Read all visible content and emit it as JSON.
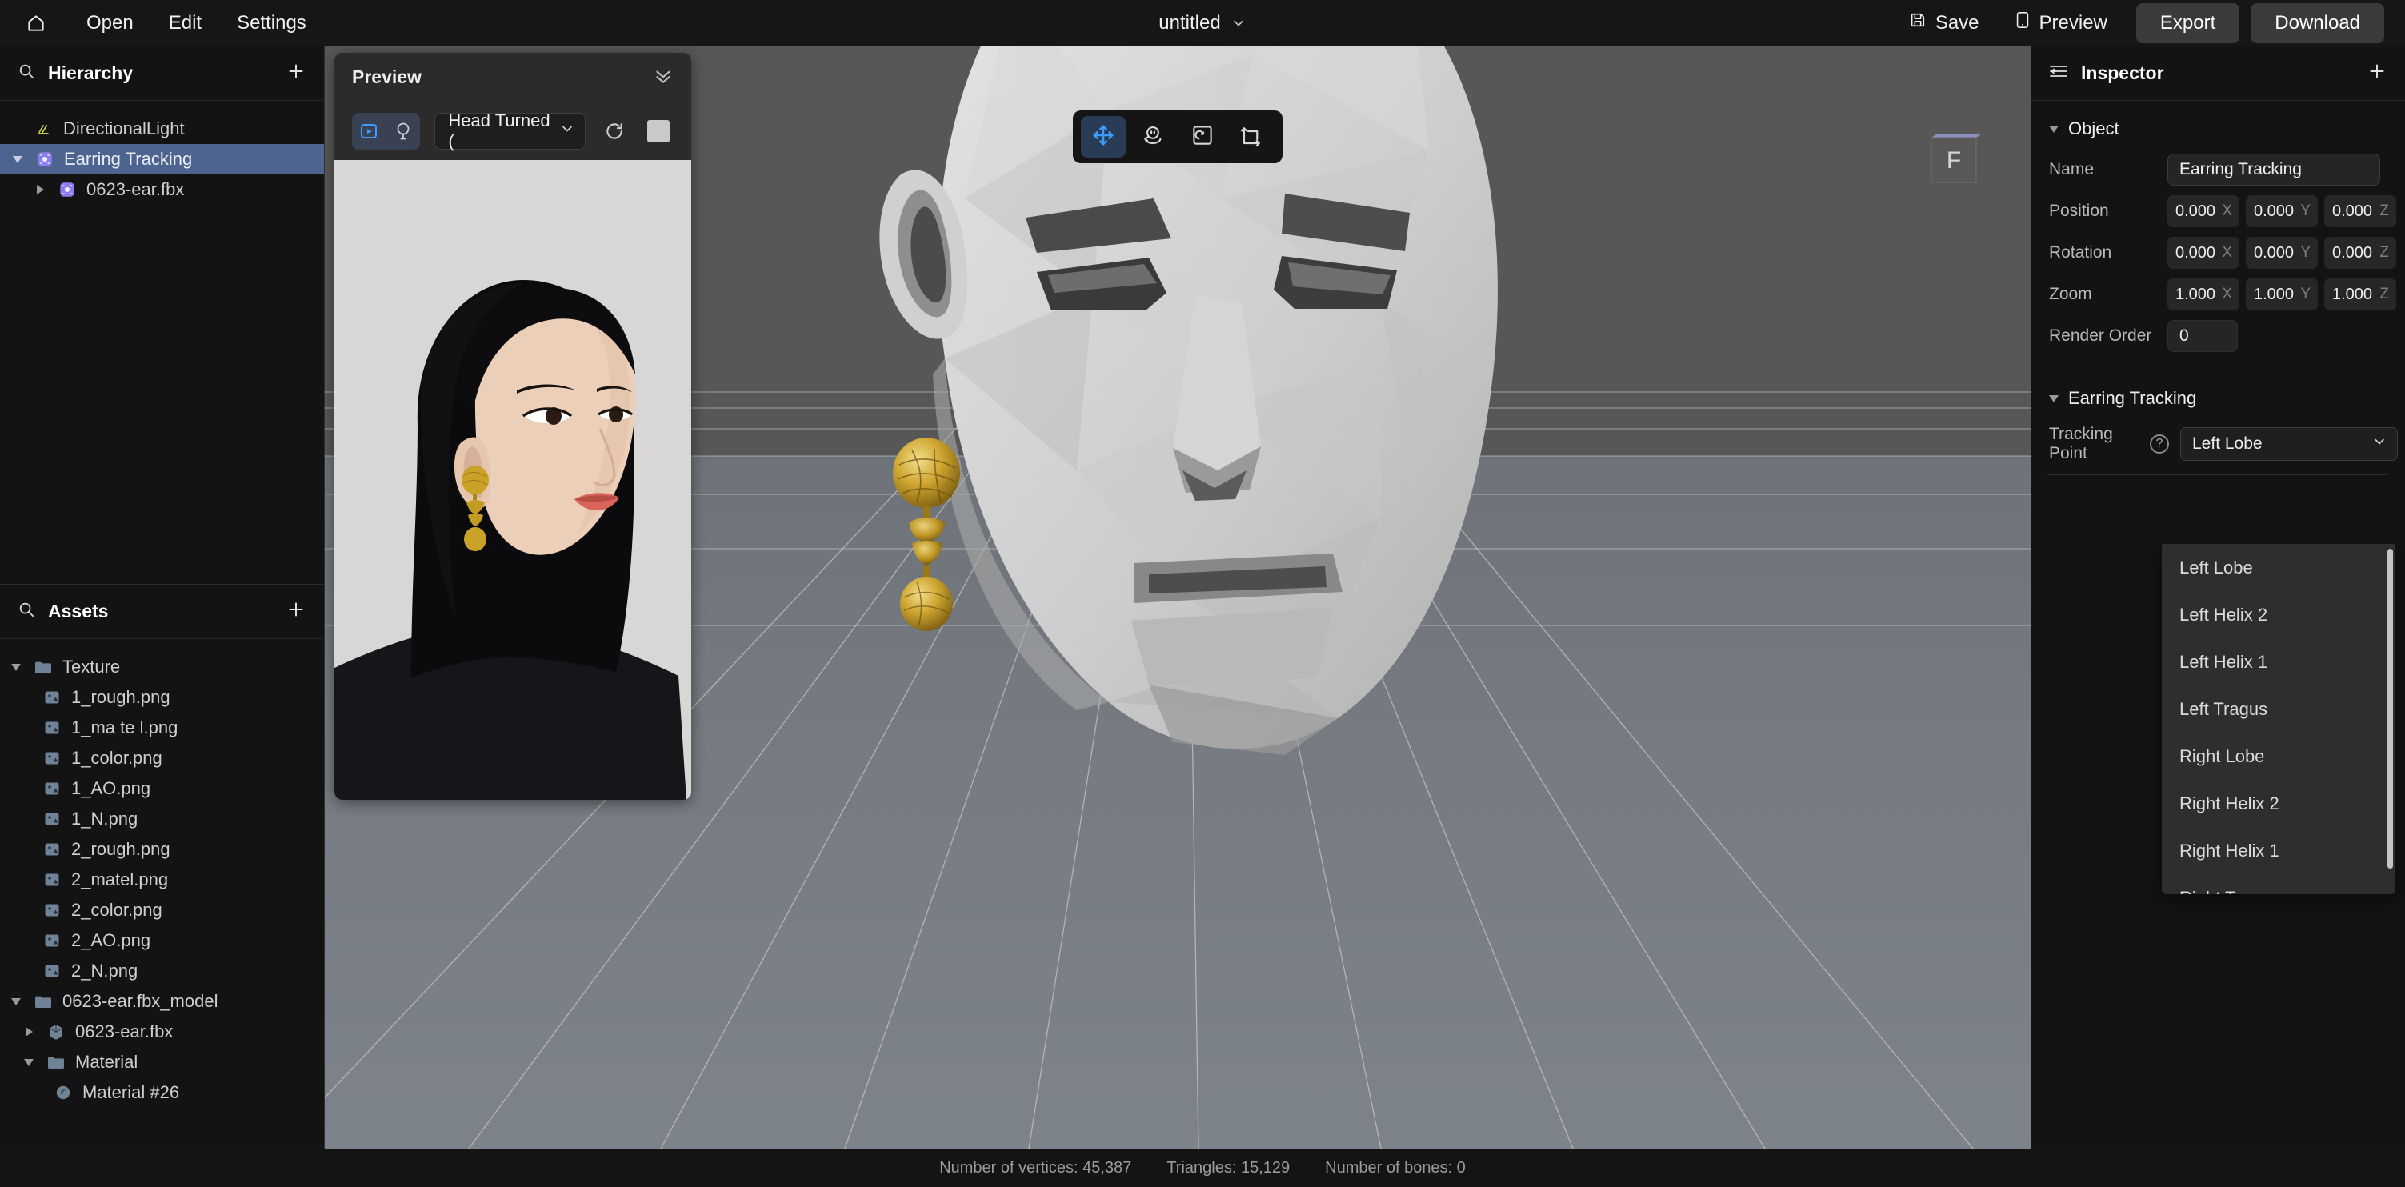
{
  "topbar": {
    "home_icon": "home-icon",
    "menus": [
      "Open",
      "Edit",
      "Settings"
    ],
    "title": "untitled",
    "title_caret": "chevron-down-icon",
    "save_label": "Save",
    "save_icon": "floppy-disk-icon",
    "preview_label": "Preview",
    "preview_icon": "mobile-phone-icon",
    "export_label": "Export",
    "download_label": "Download"
  },
  "hierarchy": {
    "search_icon": "search-icon",
    "title": "Hierarchy",
    "add_icon": "plus-icon",
    "items": [
      {
        "label": "DirectionalLight",
        "icon": "light-icon",
        "depth": 1,
        "caret": "none",
        "selected": false
      },
      {
        "label": "Earring Tracking",
        "icon": "node-icon",
        "depth": 1,
        "caret": "down",
        "selected": true
      },
      {
        "label": "0623-ear.fbx",
        "icon": "node-icon",
        "depth": 2,
        "caret": "right",
        "selected": false
      }
    ]
  },
  "assets": {
    "search_icon": "search-icon",
    "title": "Assets",
    "add_icon": "plus-icon",
    "items": [
      {
        "label": "Texture",
        "icon": "folder-icon",
        "depth": 0,
        "caret": "down"
      },
      {
        "label": "1_rough.png",
        "icon": "image-icon",
        "depth": 1,
        "caret": "none"
      },
      {
        "label": "1_ma te l.png",
        "icon": "image-icon",
        "depth": 1,
        "caret": "none"
      },
      {
        "label": "1_color.png",
        "icon": "image-icon",
        "depth": 1,
        "caret": "none"
      },
      {
        "label": "1_AO.png",
        "icon": "image-icon",
        "depth": 1,
        "caret": "none"
      },
      {
        "label": "1_N.png",
        "icon": "image-icon",
        "depth": 1,
        "caret": "none"
      },
      {
        "label": "2_rough.png",
        "icon": "image-icon",
        "depth": 1,
        "caret": "none"
      },
      {
        "label": "2_matel.png",
        "icon": "image-icon",
        "depth": 1,
        "caret": "none"
      },
      {
        "label": "2_color.png",
        "icon": "image-icon",
        "depth": 1,
        "caret": "none"
      },
      {
        "label": "2_AO.png",
        "icon": "image-icon",
        "depth": 1,
        "caret": "none"
      },
      {
        "label": "2_N.png",
        "icon": "image-icon",
        "depth": 1,
        "caret": "none"
      },
      {
        "label": "0623-ear.fbx_model",
        "icon": "folder-icon",
        "depth": 0,
        "caret": "down"
      },
      {
        "label": "0623-ear.fbx",
        "icon": "cube-icon",
        "depth": 1,
        "caret": "right"
      },
      {
        "label": "Material",
        "icon": "folder-icon",
        "depth": 1,
        "caret": "down"
      },
      {
        "label": "Material #26",
        "icon": "material-sphere-icon",
        "depth": 2,
        "caret": "none"
      }
    ]
  },
  "preview": {
    "title": "Preview",
    "collapse_icon": "double-chevron-down-icon",
    "mode_video_icon": "video-play-icon",
    "mode_light_icon": "lightbulb-icon",
    "clip_value": "Head Turned (",
    "clip_caret": "chevron-down-icon",
    "refresh_icon": "refresh-icon",
    "stop_icon": "stop-square-icon"
  },
  "viewport": {
    "tools": [
      {
        "name": "move-tool",
        "icon": "move-arrows-icon",
        "active": true
      },
      {
        "name": "rotate-tool",
        "icon": "rotate-head-icon",
        "active": false
      },
      {
        "name": "scale-tool",
        "icon": "scale-frame-icon",
        "active": false
      },
      {
        "name": "transform-tool",
        "icon": "axis-transform-icon",
        "active": false
      }
    ],
    "viewcube_face": "F"
  },
  "inspector": {
    "panel_icon": "inspector-panel-icon",
    "title": "Inspector",
    "add_icon": "plus-icon",
    "object_section": {
      "label": "Object",
      "name_label": "Name",
      "name_value": "Earring Tracking",
      "position_label": "Position",
      "position": {
        "x": "0.000",
        "y": "0.000",
        "z": "0.000"
      },
      "rotation_label": "Rotation",
      "rotation": {
        "x": "0.000",
        "y": "0.000",
        "z": "0.000"
      },
      "zoom_label": "Zoom",
      "zoom": {
        "x": "1.000",
        "y": "1.000",
        "z": "1.000"
      },
      "render_order_label": "Render Order",
      "render_order_value": "0",
      "axis_x": "X",
      "axis_y": "Y",
      "axis_z": "Z"
    },
    "earring_section": {
      "label": "Earring Tracking",
      "tracking_point_label": "Tracking Point",
      "help_icon": "question-mark-icon",
      "tracking_point_value": "Left Lobe",
      "dropdown_caret": "chevron-down-icon",
      "dropdown_open": true,
      "options": [
        "Left Lobe",
        "Left Helix 2",
        "Left Helix 1",
        "Left Tragus",
        "Right Lobe",
        "Right Helix 2",
        "Right Helix 1",
        "Right Tragus"
      ]
    }
  },
  "statusbar": {
    "vertices": "Number of vertices: 45,387",
    "triangles": "Triangles: 15,129",
    "bones": "Number of bones: 0"
  },
  "colors": {
    "accent_blue": "#3b9dff",
    "selection_blue": "#4e6490",
    "node_purple": "#8b7ff0",
    "folder_blue": "#6f8296",
    "gold": "#c9a227"
  }
}
